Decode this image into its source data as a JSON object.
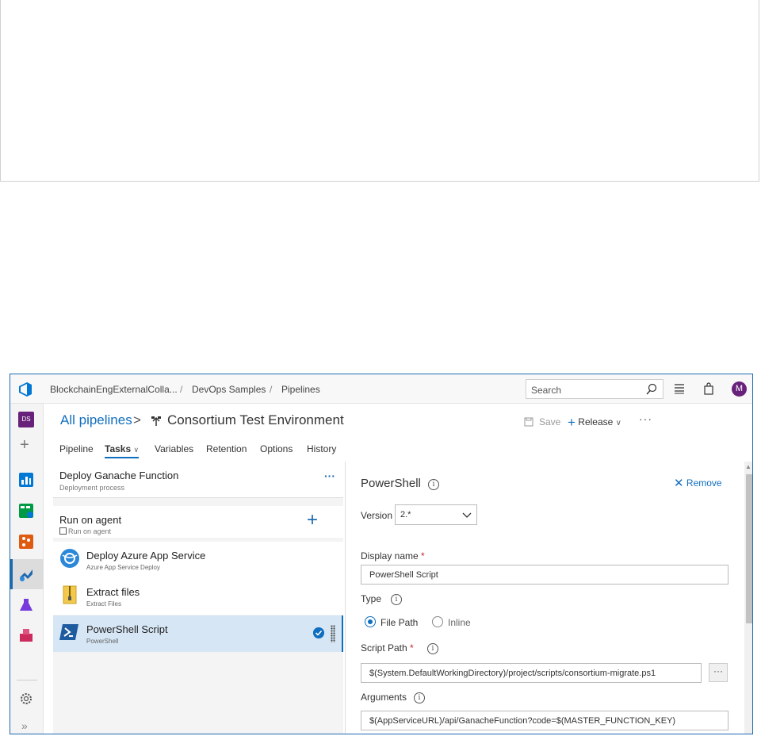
{
  "header": {
    "breadcrumb": [
      "BlockchainEngExternalColla...",
      "DevOps Samples",
      "Pipelines"
    ],
    "breadcrumb_separator": "/",
    "search_placeholder": "Search",
    "avatar_initial": "M",
    "icons": [
      "azure-devops-logo-icon",
      "search-icon",
      "list-icon",
      "shopping-bag-icon"
    ]
  },
  "rail": {
    "project_initials": "DS",
    "items": [
      "overview-icon",
      "boards-icon",
      "repos-icon",
      "pipelines-icon",
      "test-plans-icon",
      "artifacts-icon"
    ],
    "settings_icon": "gear-icon",
    "expand_icon": "double-chevron-right-icon",
    "expand_label": "»",
    "add_label": "+"
  },
  "page": {
    "all_pipelines": "All pipelines",
    "chevron": ">",
    "environment_title": "Consortium Test Environment",
    "save_label": "Save",
    "release_label": "Release",
    "more_label": "···"
  },
  "tabs": [
    {
      "label": "Pipeline"
    },
    {
      "label": "Tasks"
    },
    {
      "label": "Variables"
    },
    {
      "label": "Retention"
    },
    {
      "label": "Options"
    },
    {
      "label": "History"
    }
  ],
  "stage": {
    "title": "Deploy Ganache Function",
    "subtitle": "Deployment process",
    "more_label": "···"
  },
  "agent": {
    "title": "Run on agent",
    "subtitle": "Run on agent",
    "add_label": "+"
  },
  "tasks": [
    {
      "title": "Deploy Azure App Service",
      "subtitle": "Azure App Service Deploy",
      "icon": "azure-app-service-icon"
    },
    {
      "title": "Extract files",
      "subtitle": "Extract Files",
      "icon": "zip-archive-icon"
    },
    {
      "title": "PowerShell Script",
      "subtitle": "PowerShell",
      "icon": "powershell-icon",
      "selected": true
    }
  ],
  "detail": {
    "title": "PowerShell",
    "remove_label": "Remove",
    "version_label": "Version",
    "version_value": "2.*",
    "display_name_label": "Display name",
    "display_name_value": "PowerShell Script",
    "type_label": "Type",
    "type_options": [
      "File Path",
      "Inline"
    ],
    "type_selected": "File Path",
    "script_path_label": "Script Path",
    "script_path_value": "$(System.DefaultWorkingDirectory)/project/scripts/consortium-migrate.ps1",
    "browse_label": "···",
    "arguments_label": "Arguments",
    "arguments_value": "$(AppServiceURL)/api/GanacheFunction?code=$(MASTER_FUNCTION_KEY)",
    "required_mark": "*",
    "info_glyph": "i"
  },
  "colors": {
    "accent": "#106ebe",
    "frame_border": "#1e6ab0",
    "avatar": "#68217a",
    "required": "#c4262e",
    "selected_row": "#d6e6f5"
  }
}
